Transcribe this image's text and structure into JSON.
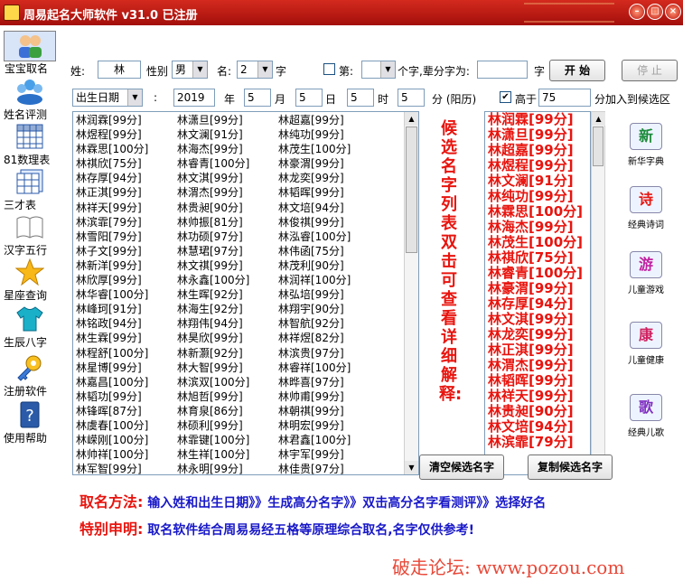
{
  "window": {
    "title": "周易起名大师软件 v31.0 已注册",
    "min": "–",
    "max": "□",
    "close": "×"
  },
  "sidebar": [
    {
      "label": "宝宝取名",
      "icon": "baby-icon"
    },
    {
      "label": "姓名评测",
      "icon": "people-icon"
    },
    {
      "label": "81数理表",
      "icon": "table-icon"
    },
    {
      "label": "三才表",
      "icon": "grid-icon"
    },
    {
      "label": "汉字五行",
      "icon": "book-icon"
    },
    {
      "label": "星座查询",
      "icon": "star-icon"
    },
    {
      "label": "生辰八字",
      "icon": "shirt-icon"
    },
    {
      "label": "注册软件",
      "icon": "key-icon"
    },
    {
      "label": "使用帮助",
      "icon": "help-icon"
    }
  ],
  "form": {
    "surname_label": "姓:",
    "surname": "林",
    "gender_label": "性别",
    "gender": "男",
    "name_label": "名:",
    "name_len": "2",
    "name_unit": "字",
    "fix_label": "第:",
    "fix_pos": "",
    "fix_suffix": "个字,辈分字为:",
    "generation_char": "",
    "char_unit": "字",
    "start_btn": "开  始",
    "stop_btn": "停  止",
    "date_mode": "出生日期",
    "colon": ":",
    "year": "2019",
    "year_label": "年",
    "month": "5",
    "month_label": "月",
    "day": "5",
    "day_label": "日",
    "hour": "5",
    "hour_label": "时",
    "minute": "5",
    "minute_label": "分 (阳历)",
    "above_label": "高于",
    "above_score": "75",
    "above_suffix": "分加入到候选区"
  },
  "names": {
    "col1": [
      "林润霖[99分]",
      "林煜程[99分]",
      "林霖思[100分]",
      "林祺欣[75分]",
      "林存厚[94分]",
      "林正淇[99分]",
      "林祥天[99分]",
      "林滨霏[79分]",
      "林雪阳[79分]",
      "林子文[99分]",
      "林新洋[99分]",
      "林欣厚[99分]",
      "林华睿[100分]",
      "林峰珂[91分]",
      "林铭政[94分]",
      "林生霖[99分]",
      "林程舒[100分]",
      "林星博[99分]",
      "林嘉昌[100分]",
      "林韬功[99分]",
      "林锋晖[87分]",
      "林虞春[100分]",
      "林嵘刚[100分]",
      "林帅祥[100分]",
      "林军智[99分]"
    ],
    "col2": [
      "林潇旦[99分]",
      "林文澜[91分]",
      "林海杰[99分]",
      "林睿青[100分]",
      "林文淇[99分]",
      "林渭杰[99分]",
      "林贵昶[90分]",
      "林帅振[81分]",
      "林功硕[97分]",
      "林慧珺[97分]",
      "林文祺[99分]",
      "林永鑫[100分]",
      "林生晖[92分]",
      "林海生[92分]",
      "林翔伟[94分]",
      "林昊欣[99分]",
      "林新灏[92分]",
      "林大智[99分]",
      "林滨双[100分]",
      "林旭哲[99分]",
      "林育泉[86分]",
      "林硕利[99分]",
      "林霏键[100分]",
      "林生祥[100分]",
      "林永明[99分]"
    ],
    "col3": [
      "林超嘉[99分]",
      "林纯功[99分]",
      "林茂生[100分]",
      "林豪渭[99分]",
      "林龙奕[99分]",
      "林韬晖[99分]",
      "林文培[94分]",
      "林俊祺[99分]",
      "林泓睿[100分]",
      "林伟函[75分]",
      "林茂利[90分]",
      "林润祥[100分]",
      "林弘培[99分]",
      "林翔宇[90分]",
      "林智航[92分]",
      "林祥煜[82分]",
      "林滨贵[97分]",
      "林睿祥[100分]",
      "林晔喜[97分]",
      "林帅甫[99分]",
      "林朝祺[99分]",
      "林明宏[99分]",
      "林君鑫[100分]",
      "林宇军[99分]",
      "林佳贵[97分]"
    ]
  },
  "vertical_note": "候选名字列表双击可查看详细解释:",
  "candidates": [
    "林润霖[99分]",
    "林潇旦[99分]",
    "林超嘉[99分]",
    "林煜程[99分]",
    "林文澜[91分]",
    "林纯功[99分]",
    "林霖思[100分]",
    "林海杰[99分]",
    "林茂生[100分]",
    "林祺欣[75分]",
    "林睿青[100分]",
    "林豪渭[99分]",
    "林存厚[94分]",
    "林文淇[99分]",
    "林龙奕[99分]",
    "林正淇[99分]",
    "林渭杰[99分]",
    "林韬晖[99分]",
    "林祥天[99分]",
    "林贵昶[90分]",
    "林文培[94分]",
    "林滨霏[79分]"
  ],
  "candidate_buttons": {
    "clear": "清空候选名字",
    "copy": "复制候选名字"
  },
  "right_panel": [
    {
      "glyph": "新",
      "label": "新华字典",
      "icon": "dictionary-icon",
      "color": "#1a8a3a"
    },
    {
      "glyph": "诗",
      "label": "经典诗词",
      "icon": "poetry-icon",
      "color": "#e8140e"
    },
    {
      "glyph": "游",
      "label": "儿童游戏",
      "icon": "game-icon",
      "color": "#c020a0"
    },
    {
      "glyph": "康",
      "label": "儿童健康",
      "icon": "health-icon",
      "color": "#d02060"
    },
    {
      "glyph": "歌",
      "label": "经典儿歌",
      "icon": "song-icon",
      "color": "#8030c0"
    }
  ],
  "footer": {
    "method_key": "取名方法:",
    "method_val": "输入姓和出生日期》》生成高分名字》》双击高分名字看测评》》选择好名",
    "notice_key": "特别申明:",
    "notice_val": "取名软件结合周易易经五格等原理综合取名,名字仅供参考!",
    "watermark": "破走论坛: www.pozou.com"
  }
}
